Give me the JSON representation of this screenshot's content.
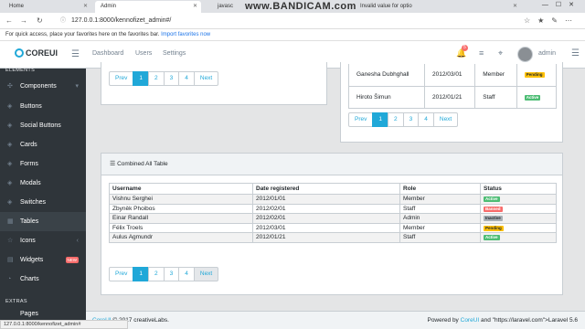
{
  "browser": {
    "tabs": [
      {
        "label": "Home"
      },
      {
        "label": "Admin"
      },
      {
        "label": "javasc"
      },
      {
        "label": "Invalid value for optio"
      },
      {
        "label": ""
      }
    ],
    "watermark": "www.BANDICAM.com",
    "url": "127.0.0.1:8000/kennofizet_admin#/",
    "favorites_text": "For quick access, place your favorites here on the favorites bar.",
    "favorites_link": "Import favorites now",
    "status_url": "127.0.0.1:8000/kennofizet_admin#"
  },
  "header": {
    "logo": "COREUI",
    "nav": [
      "Dashboard",
      "Users",
      "Settings"
    ],
    "notif_count": "5",
    "user": "admin"
  },
  "sidebar": {
    "section_top": "ELEMENTS",
    "items": [
      {
        "label": "Components",
        "icon": "puzzle-icon"
      },
      {
        "label": "Buttons",
        "icon": "cursor-icon"
      },
      {
        "label": "Social Buttons",
        "icon": "share-icon"
      },
      {
        "label": "Cards",
        "icon": "card-icon"
      },
      {
        "label": "Forms",
        "icon": "note-icon"
      },
      {
        "label": "Modals",
        "icon": "modal-icon"
      },
      {
        "label": "Switches",
        "icon": "switch-icon"
      },
      {
        "label": "Tables",
        "icon": "grid-icon"
      },
      {
        "label": "Icons",
        "icon": "star-icon"
      },
      {
        "label": "Widgets",
        "icon": "calculator-icon",
        "badge": "NEW"
      },
      {
        "label": "Charts",
        "icon": "pie-chart-icon"
      }
    ],
    "section_bottom": "EXTRAS",
    "partial_item": "Pages"
  },
  "top_left_card": {
    "pagination": [
      "Prev",
      "1",
      "2",
      "3",
      "4",
      "Next"
    ]
  },
  "top_right_card": {
    "rows": [
      {
        "username": "Ganesha Dubhghall",
        "date": "2012/03/01",
        "role": "Member",
        "status": "Pending"
      },
      {
        "username": "Hiroto Šimun",
        "date": "2012/01/21",
        "role": "Staff",
        "status": "Active"
      }
    ],
    "pagination": [
      "Prev",
      "1",
      "2",
      "3",
      "4",
      "Next"
    ]
  },
  "combined_table": {
    "title": "Combined All Table",
    "columns": [
      "Username",
      "Date registered",
      "Role",
      "Status"
    ],
    "rows": [
      {
        "username": "Vishnu Serghei",
        "date": "2012/01/01",
        "role": "Member",
        "status": "Active"
      },
      {
        "username": "Zbyněk Phoibos",
        "date": "2012/02/01",
        "role": "Staff",
        "status": "Banned"
      },
      {
        "username": "Einar Randall",
        "date": "2012/02/01",
        "role": "Admin",
        "status": "Inactive"
      },
      {
        "username": "Félix Troels",
        "date": "2012/03/01",
        "role": "Member",
        "status": "Pending"
      },
      {
        "username": "Aulus Agmundr",
        "date": "2012/01/21",
        "role": "Staff",
        "status": "Active"
      }
    ],
    "pagination": [
      "Prev",
      "1",
      "2",
      "3",
      "4",
      "Next"
    ]
  },
  "footer": {
    "brand": "CoreUI",
    "copyright": "© 2017 creativeLabs.",
    "powered_prefix": "Powered by",
    "powered_link": "CoreUI",
    "powered_suffix": "and \"https://laravel.com\">Laravel 5.6"
  },
  "colors": {
    "primary": "#20a8d8",
    "sidebar": "#2f353a",
    "active": "#4dbd74",
    "banned": "#f86c6b",
    "pending": "#ffc107",
    "inactive": "#a8b0b6"
  }
}
